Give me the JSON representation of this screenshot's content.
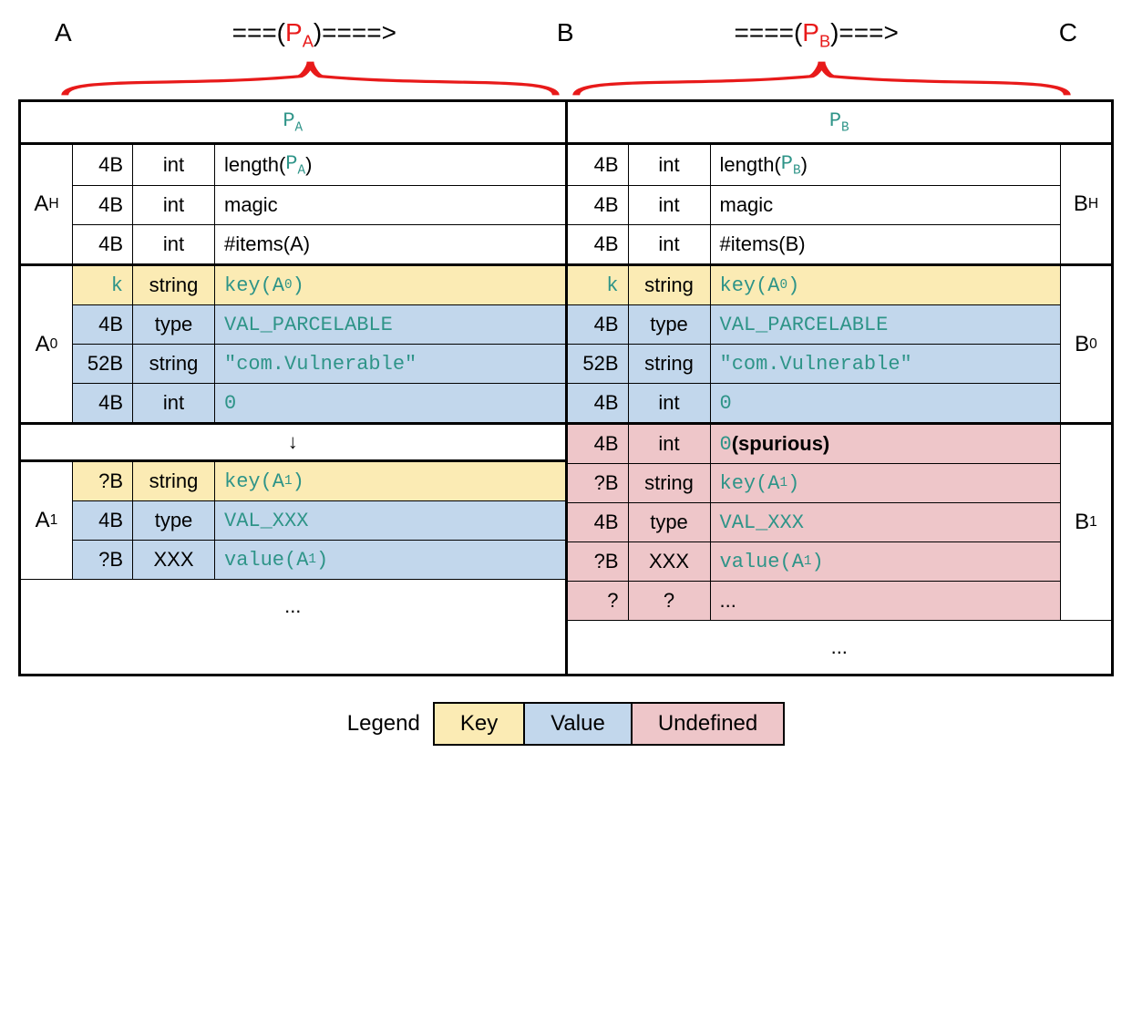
{
  "flow": {
    "A": "A",
    "B": "B",
    "C": "C",
    "arrow_left_pre": "===(",
    "arrow_left_mid_main": "P",
    "arrow_left_mid_sub": "A",
    "arrow_left_post": ")====>",
    "arrow_right_pre": "====(",
    "arrow_right_mid_main": "P",
    "arrow_right_mid_sub": "B",
    "arrow_right_post": ")===>"
  },
  "left": {
    "title_main": "P",
    "title_sub": "A",
    "header_side": "A",
    "header_side_sub": "H",
    "a0_side": "A",
    "a0_side_sub": "0",
    "a1_side": "A",
    "a1_side_sub": "1",
    "header": [
      {
        "size": "4B",
        "type": "int",
        "desc_pre": "length(",
        "desc_mid_main": "P",
        "desc_mid_sub": "A",
        "desc_post": ")"
      },
      {
        "size": "4B",
        "type": "int",
        "desc": "magic"
      },
      {
        "size": "4B",
        "type": "int",
        "desc": "#items(A)"
      }
    ],
    "a0": [
      {
        "size": "k",
        "size_cls": "teal",
        "type": "string",
        "bg": "key",
        "desc_mono": "key(A",
        "desc_sub": "0",
        "desc_close": ")"
      },
      {
        "size": "4B",
        "type": "type",
        "bg": "val",
        "desc_mono_plain": "VAL_PARCELABLE"
      },
      {
        "size": "52B",
        "type": "string",
        "bg": "val",
        "desc_mono_plain": "\"com.Vulnerable\""
      },
      {
        "size": "4B",
        "type": "int",
        "bg": "val",
        "desc_mono_plain": "0"
      }
    ],
    "gap_arrow": "↓",
    "a1": [
      {
        "size": "?B",
        "type": "string",
        "bg": "key",
        "desc_mono": "key(A",
        "desc_sub": "1",
        "desc_close": ")"
      },
      {
        "size": "4B",
        "type": "type",
        "bg": "val",
        "desc_mono_plain": "VAL_XXX"
      },
      {
        "size": "?B",
        "type": "XXX",
        "bg": "val",
        "desc_mono": "value(A",
        "desc_sub": "1",
        "desc_close": ")"
      }
    ],
    "ellipsis": "..."
  },
  "right": {
    "title_main": "P",
    "title_sub": "B",
    "header_side": "B",
    "header_side_sub": "H",
    "b0_side": "B",
    "b0_side_sub": "0",
    "b1_side": "B",
    "b1_side_sub": "1",
    "header": [
      {
        "size": "4B",
        "type": "int",
        "desc_pre": "length(",
        "desc_mid_main": "P",
        "desc_mid_sub": "B",
        "desc_post": ")"
      },
      {
        "size": "4B",
        "type": "int",
        "desc": "magic"
      },
      {
        "size": "4B",
        "type": "int",
        "desc": "#items(B)"
      }
    ],
    "b0": [
      {
        "size": "k",
        "size_cls": "teal",
        "type": "string",
        "bg": "key",
        "desc_mono": "key(A",
        "desc_sub": "0",
        "desc_close": ")"
      },
      {
        "size": "4B",
        "type": "type",
        "bg": "val",
        "desc_mono_plain": "VAL_PARCELABLE"
      },
      {
        "size": "52B",
        "type": "string",
        "bg": "val",
        "desc_mono_plain": "\"com.Vulnerable\""
      },
      {
        "size": "4B",
        "type": "int",
        "bg": "val",
        "desc_mono_plain": "0"
      }
    ],
    "b1": [
      {
        "size": "4B",
        "type": "int",
        "bg": "undef",
        "desc_mono_plain": "0",
        "desc_suffix_bold": " (spurious)"
      },
      {
        "size": "?B",
        "type": "string",
        "bg": "undef",
        "desc_mono": "key(A",
        "desc_sub": "1",
        "desc_close": ")"
      },
      {
        "size": "4B",
        "type": "type",
        "bg": "undef",
        "desc_mono_plain": "VAL_XXX"
      },
      {
        "size": "?B",
        "type": "XXX",
        "bg": "undef",
        "desc_mono": "value(A",
        "desc_sub": "1",
        "desc_close": ")"
      },
      {
        "size": "?",
        "type": "?",
        "bg": "undef",
        "desc": "..."
      }
    ],
    "ellipsis": "..."
  },
  "legend": {
    "label": "Legend",
    "key": "Key",
    "value": "Value",
    "undefined": "Undefined"
  }
}
